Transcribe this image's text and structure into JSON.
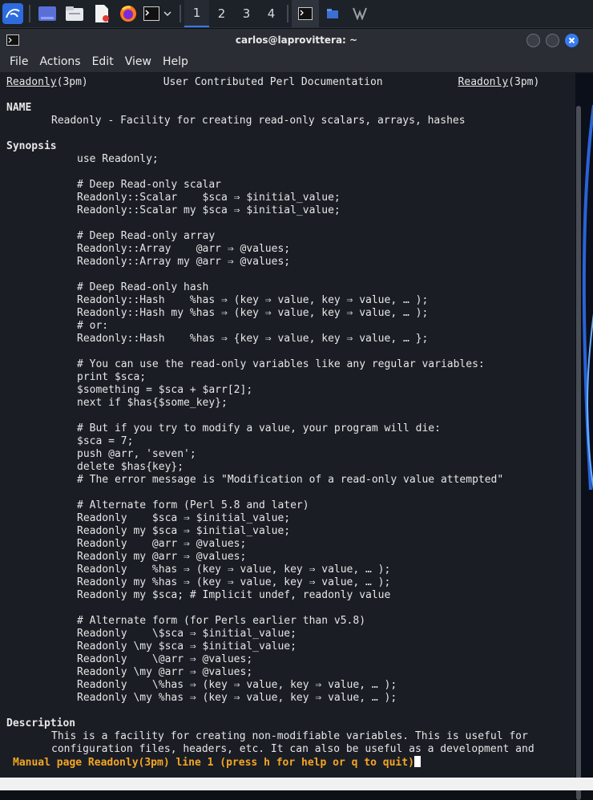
{
  "taskbar": {
    "workspaces": [
      "1",
      "2",
      "3",
      "4"
    ],
    "active_workspace": "1"
  },
  "window": {
    "title": "carlos@laprovittera: ~"
  },
  "menubar": [
    "File",
    "Actions",
    "Edit",
    "View",
    "Help"
  ],
  "man": {
    "header_left": "Readonly",
    "header_left_sect": "(3pm)",
    "header_center": "User Contributed Perl Documentation",
    "header_right": "Readonly",
    "header_right_sect": "(3pm)",
    "name_heading": "NAME",
    "name_text": "Readonly - Facility for creating read-only scalars, arrays, hashes",
    "synopsis_heading": "Synopsis",
    "synopsis_lines": [
      "use Readonly;",
      "",
      "# Deep Read-only scalar",
      "Readonly::Scalar    $sca ⇒ $initial_value;",
      "Readonly::Scalar my $sca ⇒ $initial_value;",
      "",
      "# Deep Read-only array",
      "Readonly::Array    @arr ⇒ @values;",
      "Readonly::Array my @arr ⇒ @values;",
      "",
      "# Deep Read-only hash",
      "Readonly::Hash    %has ⇒ (key ⇒ value, key ⇒ value, … );",
      "Readonly::Hash my %has ⇒ (key ⇒ value, key ⇒ value, … );",
      "# or:",
      "Readonly::Hash    %has ⇒ {key ⇒ value, key ⇒ value, … };",
      "",
      "# You can use the read-only variables like any regular variables:",
      "print $sca;",
      "$something = $sca + $arr[2];",
      "next if $has{$some_key};",
      "",
      "# But if you try to modify a value, your program will die:",
      "$sca = 7;",
      "push @arr, 'seven';",
      "delete $has{key};",
      "# The error message is \"Modification of a read-only value attempted\"",
      "",
      "# Alternate form (Perl 5.8 and later)",
      "Readonly    $sca ⇒ $initial_value;",
      "Readonly my $sca ⇒ $initial_value;",
      "Readonly    @arr ⇒ @values;",
      "Readonly my @arr ⇒ @values;",
      "Readonly    %has ⇒ (key ⇒ value, key ⇒ value, … );",
      "Readonly my %has ⇒ (key ⇒ value, key ⇒ value, … );",
      "Readonly my $sca; # Implicit undef, readonly value",
      "",
      "# Alternate form (for Perls earlier than v5.8)",
      "Readonly    \\$sca ⇒ $initial_value;",
      "Readonly \\my $sca ⇒ $initial_value;",
      "Readonly    \\@arr ⇒ @values;",
      "Readonly \\my @arr ⇒ @values;",
      "Readonly    \\%has ⇒ (key ⇒ value, key ⇒ value, … );",
      "Readonly \\my %has ⇒ (key ⇒ value, key ⇒ value, … );"
    ],
    "description_heading": "Description",
    "description_lines": [
      "This is a facility for creating non-modifiable variables. This is useful for",
      "configuration files, headers, etc. It can also be useful as a development and"
    ],
    "status_line": "Manual page Readonly(3pm) line 1 (press h for help or q to quit)"
  },
  "colors": {
    "status": "#f5a623",
    "accent": "#367bf0",
    "close_button": "#367bf0"
  }
}
